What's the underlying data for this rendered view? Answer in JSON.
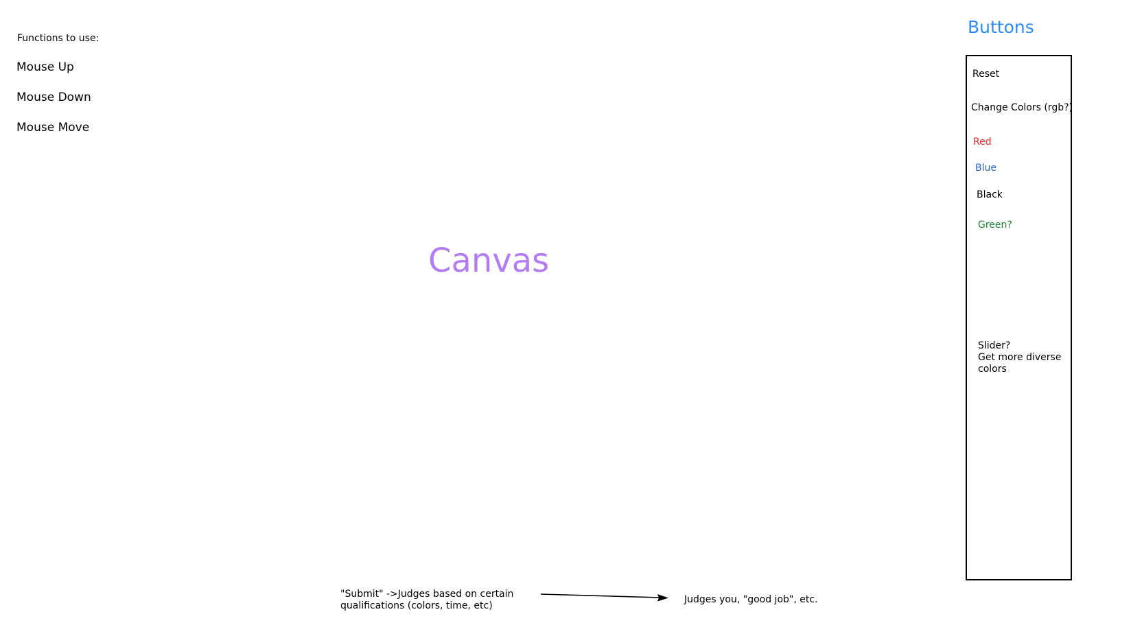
{
  "functions": {
    "heading": "Functions to use:",
    "items": [
      "Mouse Up",
      "Mouse Down",
      "Mouse Move"
    ]
  },
  "canvas": {
    "label": "Canvas",
    "label_color": "#b37cf5"
  },
  "buttons": {
    "heading": "Buttons",
    "heading_color": "#2a8bf2",
    "reset": "Reset",
    "change_colors": "Change Colors (rgb?)",
    "colors": [
      {
        "label": "Red",
        "color": "#e8262a"
      },
      {
        "label": "Blue",
        "color": "#2b63c6"
      },
      {
        "label": "Black",
        "color": "#000000"
      },
      {
        "label": "Green?",
        "color": "#1d7f35"
      }
    ],
    "slider_note": "Slider?\nGet more diverse colors"
  },
  "flow": {
    "submit_note": "\"Submit\" ->Judges based on certain qualifications (colors, time, etc)",
    "judges_note": "Judges you, \"good job\", etc."
  }
}
